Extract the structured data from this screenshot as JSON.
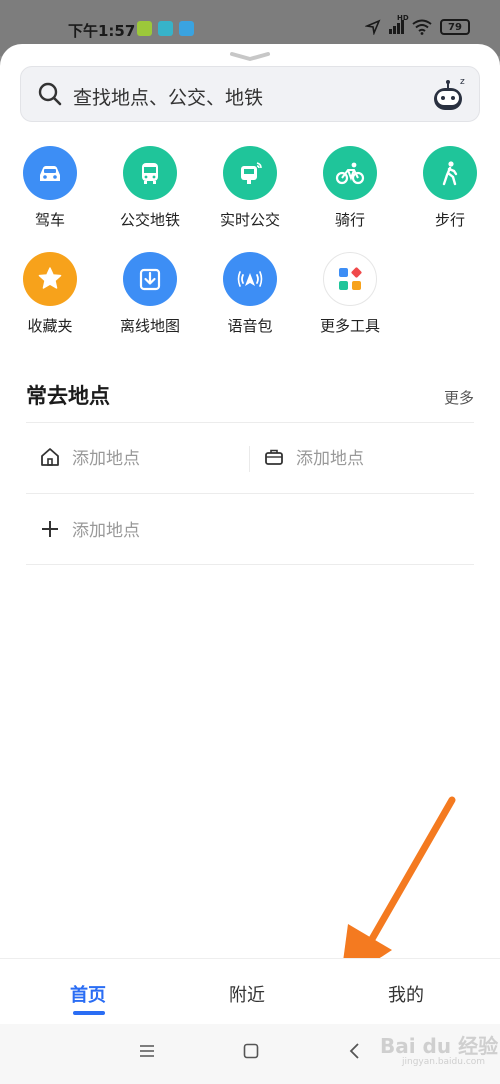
{
  "status": {
    "time": "下午1:57",
    "battery": "79",
    "network": "HD"
  },
  "search": {
    "placeholder": "查找地点、公交、地铁"
  },
  "tools": [
    {
      "label": "驾车",
      "icon": "car-icon",
      "color": "#3d8ef5"
    },
    {
      "label": "公交地铁",
      "icon": "bus-icon",
      "color": "#1fc59a"
    },
    {
      "label": "实时公交",
      "icon": "realtime-bus-icon",
      "color": "#1fc59a"
    },
    {
      "label": "骑行",
      "icon": "bicycle-icon",
      "color": "#1fc59a"
    },
    {
      "label": "步行",
      "icon": "walk-icon",
      "color": "#1fc59a"
    },
    {
      "label": "收藏夹",
      "icon": "star-icon",
      "color": "#f7a21b"
    },
    {
      "label": "离线地图",
      "icon": "download-icon",
      "color": "#3d8ef5"
    },
    {
      "label": "语音包",
      "icon": "voice-icon",
      "color": "#3d8ef5"
    },
    {
      "label": "更多工具",
      "icon": "more-tools-icon",
      "color": "#ffffff"
    }
  ],
  "frequent": {
    "title": "常去地点",
    "more": "更多",
    "home_label": "添加地点",
    "work_label": "添加地点",
    "add_label": "添加地点"
  },
  "tabs": [
    {
      "label": "首页",
      "active": true
    },
    {
      "label": "附近",
      "active": false
    },
    {
      "label": "我的",
      "active": false
    }
  ],
  "watermark": {
    "text": "Bai du 经验",
    "sub": "jingyan.baidu.com"
  }
}
